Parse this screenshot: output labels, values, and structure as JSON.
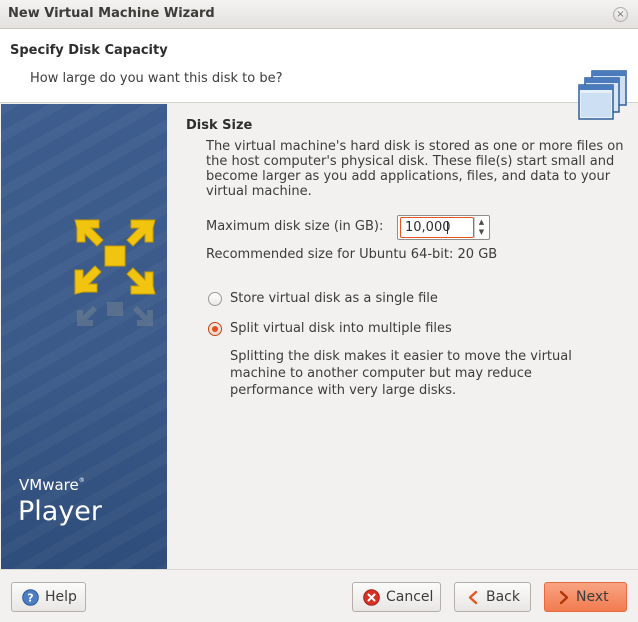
{
  "window": {
    "title": "New Virtual Machine Wizard",
    "close_glyph": "×"
  },
  "header": {
    "title": "Specify Disk Capacity",
    "subtitle": "How large do you want this disk to be?",
    "icon": "stacked-windows-icon"
  },
  "sidebar": {
    "brand_line1": "VMware",
    "brand_reg": "®",
    "brand_line2": "Player",
    "logo_icon": "vmware-logo-icon"
  },
  "disk_size": {
    "section_title": "Disk Size",
    "description": "The virtual machine's hard disk is stored as one or more files on the host computer's physical disk. These file(s) start small and become larger as you add applications, files, and data to your virtual machine.",
    "max_label": "Maximum disk size (in GB):",
    "max_value": "10,000",
    "recommended": "Recommended size for Ubuntu 64-bit: 20 GB"
  },
  "storage_options": {
    "single_label": "Store virtual disk as a single file",
    "single_checked": false,
    "split_label": "Split virtual disk into multiple files",
    "split_checked": true,
    "split_description": "Splitting the disk makes it easier to move the virtual machine to another computer but may reduce performance with very large disks."
  },
  "buttons": {
    "help": "Help",
    "cancel": "Cancel",
    "back": "Back",
    "next": "Next"
  },
  "colors": {
    "accent": "#e95420",
    "sidebar_blue": "#3b5a89",
    "logo_yellow": "#f1c40f"
  }
}
